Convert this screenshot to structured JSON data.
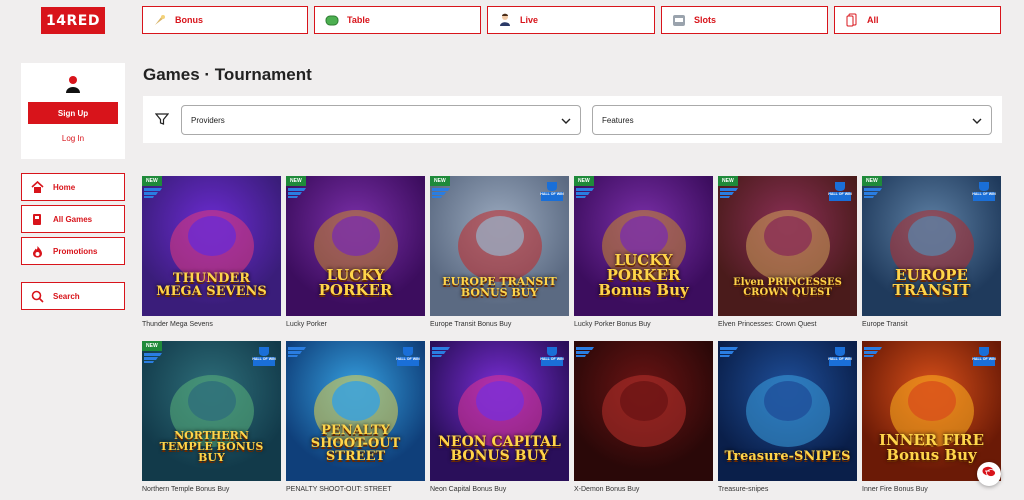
{
  "brand": {
    "logo_text": "14RED",
    "accent": "#d8141b"
  },
  "categories": [
    {
      "label": "Bonus",
      "icon": "bonus-icon"
    },
    {
      "label": "Table",
      "icon": "table-icon"
    },
    {
      "label": "Live",
      "icon": "live-dealer-icon"
    },
    {
      "label": "Slots",
      "icon": "slot-machine-icon"
    },
    {
      "label": "All",
      "icon": "cards-icon"
    }
  ],
  "auth": {
    "signup": "Sign Up",
    "login": "Log In",
    "icon": "user-icon"
  },
  "sidebar": {
    "items": [
      {
        "label": "Home",
        "icon": "home-icon"
      },
      {
        "label": "All Games",
        "icon": "games-icon"
      },
      {
        "label": "Promotions",
        "icon": "flame-icon"
      }
    ],
    "search": {
      "label": "Search",
      "icon": "search-icon"
    }
  },
  "main": {
    "title": "Games · Tournament",
    "filters": {
      "providers": "Providers",
      "features": "Features",
      "icon": "funnel-icon"
    }
  },
  "games": [
    {
      "name": "Thunder Mega Sevens",
      "art": "THUNDER MEGA SEVENS",
      "new": true,
      "hall": false
    },
    {
      "name": "Lucky Porker",
      "art": "LUCKY PORKER",
      "new": true,
      "hall": false
    },
    {
      "name": "Europe Transit Bonus Buy",
      "art": "EUROPE TRANSIT BONUS BUY",
      "new": true,
      "hall": true
    },
    {
      "name": "Lucky Porker Bonus Buy",
      "art": "LUCKY PORKER Bonus Buy",
      "new": true,
      "hall": false
    },
    {
      "name": "Elven Princesses: Crown Quest",
      "art": "Elven PRINCESSES CROWN QUEST",
      "new": true,
      "hall": true
    },
    {
      "name": "Europe Transit",
      "art": "EUROPE TRANSIT",
      "new": true,
      "hall": true
    },
    {
      "name": "Northern Temple Bonus Buy",
      "art": "NORTHERN TEMPLE BONUS BUY",
      "new": true,
      "hall": true
    },
    {
      "name": "PENALTY SHOOT-OUT: STREET",
      "art": "PENALTY SHOOT-OUT STREET",
      "new": false,
      "hall": true
    },
    {
      "name": "Neon Capital Bonus Buy",
      "art": "NEON CAPITAL BONUS BUY",
      "new": false,
      "hall": true
    },
    {
      "name": "X-Demon Bonus Buy",
      "art": "",
      "new": false,
      "hall": false
    },
    {
      "name": "Treasure-snipes",
      "art": "Treasure-SNIPES",
      "new": false,
      "hall": true
    },
    {
      "name": "Inner Fire Bonus Buy",
      "art": "INNER FIRE Bonus Buy",
      "new": false,
      "hall": true
    }
  ],
  "badges": {
    "new": "NEW",
    "hall": "HALL OF WIN"
  },
  "chat": {
    "icon": "chat-icon"
  }
}
